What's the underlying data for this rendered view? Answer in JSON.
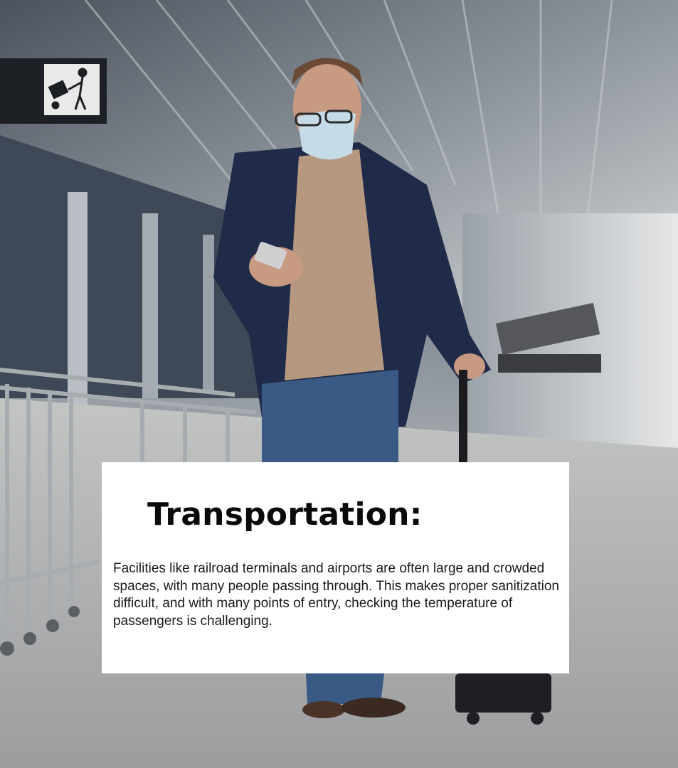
{
  "card": {
    "title": "Transportation:",
    "body": "Facilities like railroad terminals and airports are often large and crowded spaces, with many people passing through. This makes proper sanitization difficult, and with many points of entry, checking the temperature of passengers is challenging."
  },
  "photo": {
    "scene": "airport terminal walkway",
    "sign_icon": "luggage-cart-icon"
  },
  "colors": {
    "card_background": "#ffffff",
    "title_color": "#0a0a0a",
    "body_color": "#1a1a1a"
  }
}
